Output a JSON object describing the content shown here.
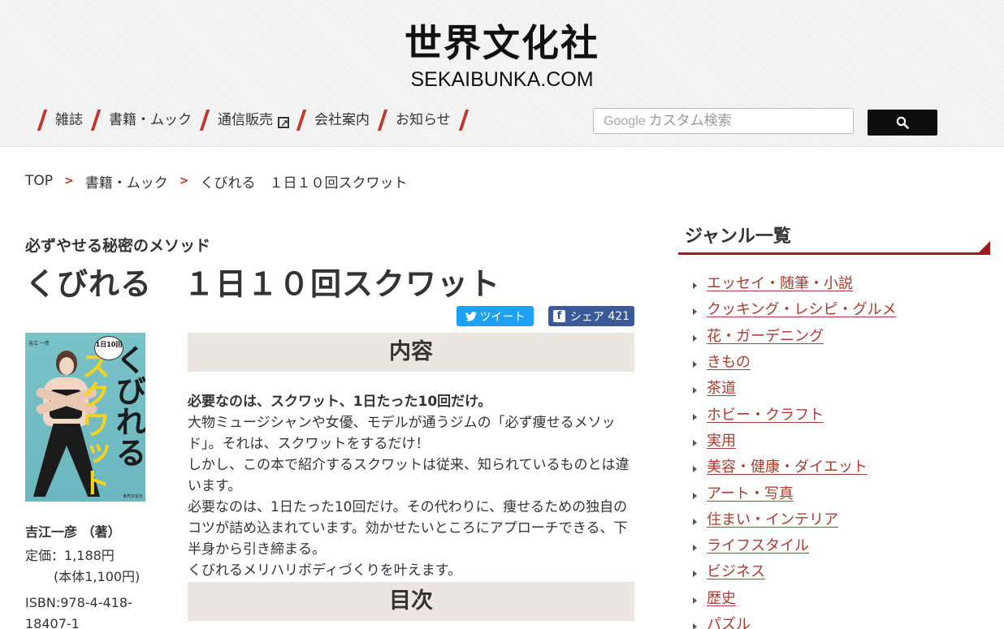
{
  "site": {
    "logo_ja": "世界文化社",
    "logo_en": "SEKAIBUNKA.COM"
  },
  "nav": {
    "items": [
      {
        "label": "雑誌"
      },
      {
        "label": "書籍・ムック"
      },
      {
        "label": "通信販売"
      },
      {
        "label": "会社案内"
      },
      {
        "label": "お知らせ"
      }
    ]
  },
  "search": {
    "google_logo": "Google",
    "placeholder": "カスタム検索",
    "button_icon": "search-icon"
  },
  "breadcrumb": {
    "items": [
      "TOP",
      "書籍・ムック",
      "くびれる　１日１０回スクワット"
    ],
    "separator": ">"
  },
  "book": {
    "catch": "必ずやせる秘密のメソッド",
    "title": "くびれる　１日１０回スクワット",
    "author": "吉江一彦 （著）",
    "price": "定価：1,188円",
    "price_sub": "(本体1,100円)",
    "isbn": "ISBN:978-4-418-18407-1",
    "cover": {
      "title_yellow": "スクワット",
      "title_black": "くびれる",
      "badge": "1日10回"
    }
  },
  "social": {
    "tweet_label": "ツイート",
    "share_label": "シェア",
    "share_count": "421"
  },
  "sections": {
    "content_heading": "内容",
    "toc_heading": "目次"
  },
  "content": {
    "lead": "必要なのは、スクワット、1日たった10回だけ。",
    "p1": "大物ミュージシャンや女優、モデルが通うジムの「必ず痩せるメソッド」。それは、スクワットをするだけ！",
    "p2": "しかし、この本で紹介するスクワットは従来、知られているものとは違います。",
    "p3": "必要なのは、1日たった10回だけ。その代わりに、痩せるための独自のコツが詰め込まれています。効かせたいところにアプローチできる、下半身から引き締まる。",
    "p4": "くびれるメリハリボディづくりを叶えます。"
  },
  "sidebar": {
    "heading": "ジャンル一覧",
    "genres": [
      "エッセイ・随筆・小説",
      "クッキング・レシピ・グルメ",
      "花・ガーデニング",
      "きもの",
      "茶道",
      "ホビー・クラフト",
      "実用",
      "美容・健康・ダイエット",
      "アート・写真",
      "住まい・インテリア",
      "ライフスタイル",
      "ビジネス",
      "歴史",
      "パズル"
    ]
  },
  "colors": {
    "accent_red": "#c0392b",
    "sidebar_rule": "#9b1c1c",
    "link": "#b03a2e",
    "section_bg": "#ebe7e0",
    "twitter": "#1da1f2",
    "facebook": "#3b5998"
  }
}
